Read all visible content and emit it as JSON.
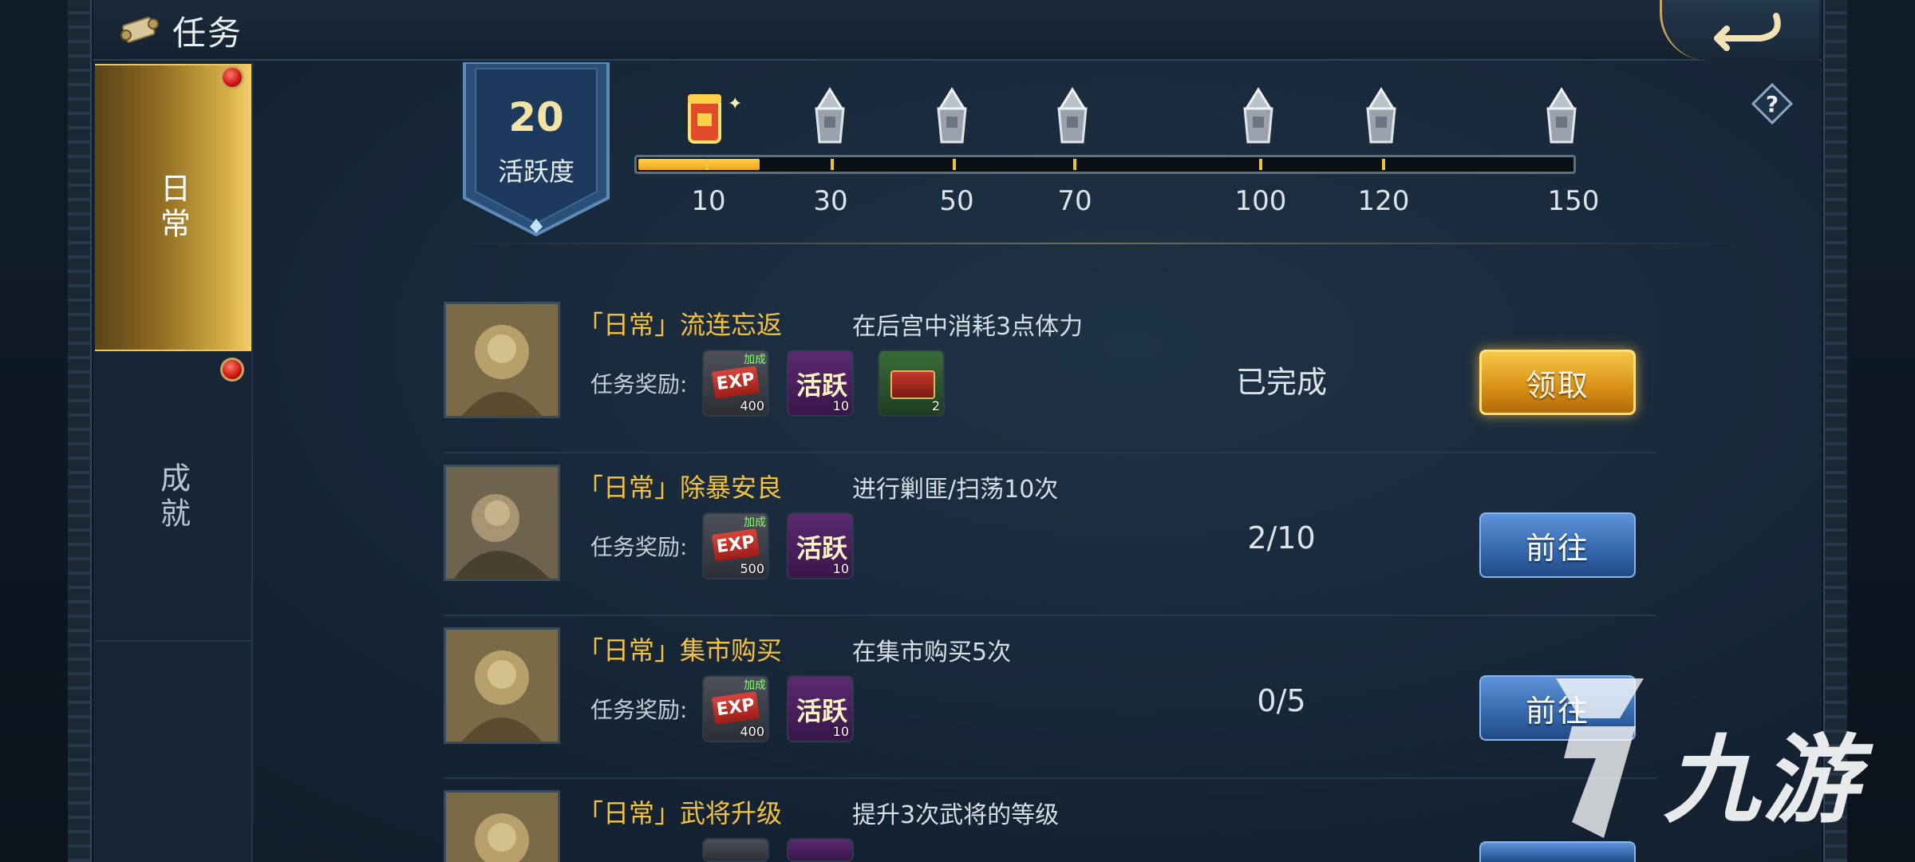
{
  "header": {
    "title": "任务"
  },
  "tabs": [
    {
      "label": "日常",
      "active": true,
      "badge": true
    },
    {
      "label": "成就",
      "active": false,
      "badge": true
    }
  ],
  "activity": {
    "value": "20",
    "label": "活跃度",
    "progress": 0.13,
    "milestones": [
      "10",
      "30",
      "50",
      "70",
      "100",
      "120",
      "150"
    ]
  },
  "tasks": [
    {
      "name": "「日常」流连忘返",
      "desc": "在后宫中消耗3点体力",
      "reward_label": "任务奖励:",
      "rewards": [
        {
          "type": "exp",
          "icon": "EXP",
          "bonus": "加成",
          "count": "400"
        },
        {
          "type": "active",
          "icon": "活跃",
          "count": "10"
        },
        {
          "type": "chest",
          "icon": "",
          "count": "2"
        }
      ],
      "status": "已完成",
      "button": "领取",
      "button_type": "claim"
    },
    {
      "name": "「日常」除暴安良",
      "desc": "进行剿匪/扫荡10次",
      "reward_label": "任务奖励:",
      "rewards": [
        {
          "type": "exp",
          "icon": "EXP",
          "bonus": "加成",
          "count": "500"
        },
        {
          "type": "active",
          "icon": "活跃",
          "count": "10"
        }
      ],
      "status": "2/10",
      "button": "前往",
      "button_type": "go"
    },
    {
      "name": "「日常」集市购买",
      "desc": "在集市购买5次",
      "reward_label": "任务奖励:",
      "rewards": [
        {
          "type": "exp",
          "icon": "EXP",
          "bonus": "加成",
          "count": "400"
        },
        {
          "type": "active",
          "icon": "活跃",
          "count": "10"
        }
      ],
      "status": "0/5",
      "button": "前往",
      "button_type": "go"
    },
    {
      "name": "「日常」武将升级",
      "desc": "提升3次武将的等级",
      "reward_label": "",
      "rewards": [],
      "status": "",
      "button": "",
      "button_type": "go"
    }
  ],
  "watermark": {
    "text": "九游"
  },
  "colors": {
    "accent_gold": "#f4c13c",
    "claim_button": "#e0a020",
    "go_button": "#3d72b8"
  }
}
